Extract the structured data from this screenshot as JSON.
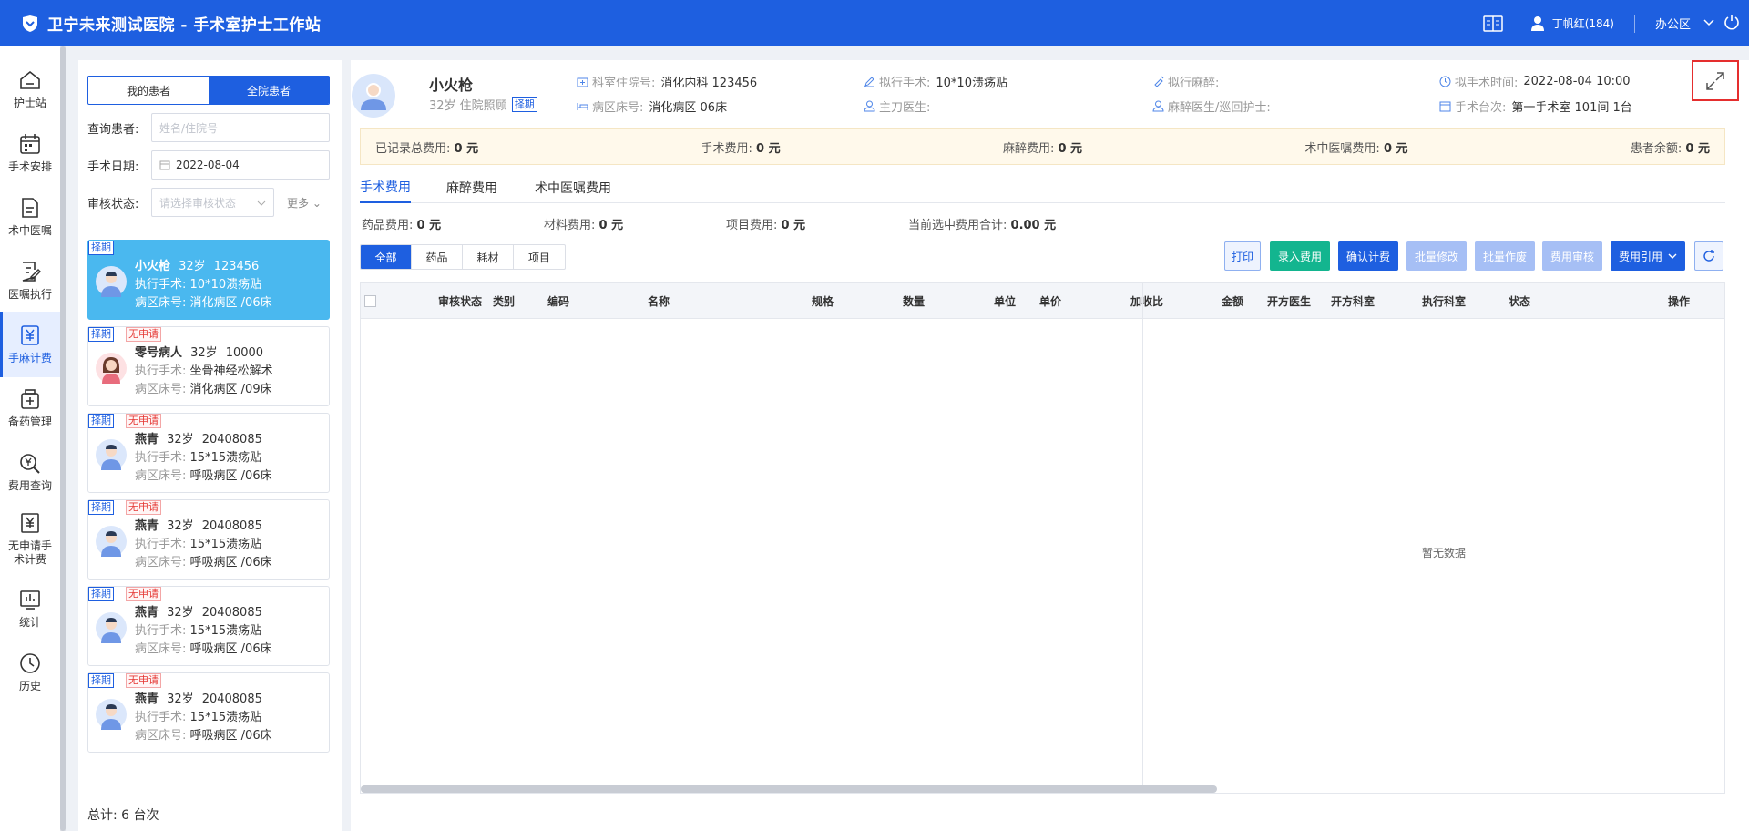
{
  "app": {
    "title": "卫宁未来测试医院 - 手术室护士工作站",
    "user": "丁帆红(184)",
    "office": "办公区"
  },
  "colors": {
    "primary": "#1e5fe0",
    "selected_card": "#4ab8ef",
    "green": "#13b58f",
    "disabled": "#a6bff5"
  },
  "nav": [
    {
      "label": "护士站",
      "icon": "home-icon"
    },
    {
      "label": "手术安排",
      "icon": "calendar-icon"
    },
    {
      "label": "术中医嘱",
      "icon": "document-icon"
    },
    {
      "label": "医嘱执行",
      "icon": "edit-document-icon"
    },
    {
      "label": "手麻计费",
      "icon": "yen-icon"
    },
    {
      "label": "备药管理",
      "icon": "medicine-icon"
    },
    {
      "label": "费用查询",
      "icon": "yen-search-icon"
    },
    {
      "label": "无申请手术计费",
      "icon": "yen-document-icon"
    },
    {
      "label": "统计",
      "icon": "chart-icon"
    },
    {
      "label": "历史",
      "icon": "clock-icon"
    }
  ],
  "left": {
    "seg_my": "我的患者",
    "seg_all": "全院患者",
    "query_label": "查询患者:",
    "query_placeholder": "姓名/住院号",
    "date_label": "手术日期:",
    "date_value": "2022-08-04",
    "audit_label": "审核状态:",
    "audit_placeholder": "请选择审核状态",
    "more": "更多",
    "total": "总计:  6 台次"
  },
  "patients": [
    {
      "tag": "择期",
      "tag2": "",
      "name": "小火枪",
      "age": "32岁",
      "id": "123456",
      "surgery_k": "执行手术:",
      "surgery": "10*10溃疡贴",
      "bed_k": "病区床号:",
      "bed": "消化病区 /06床",
      "avatar": "male"
    },
    {
      "tag": "择期",
      "tag2": "无申请",
      "name": "零号病人",
      "age": "32岁",
      "id": "10000",
      "surgery_k": "执行手术:",
      "surgery": "坐骨神经松解术",
      "bed_k": "病区床号:",
      "bed": "消化病区 /09床",
      "avatar": "female"
    },
    {
      "tag": "择期",
      "tag2": "无申请",
      "name": "燕青",
      "age": "32岁",
      "id": "20408085",
      "surgery_k": "执行手术:",
      "surgery": "15*15溃疡贴",
      "bed_k": "病区床号:",
      "bed": "呼吸病区 /06床",
      "avatar": "male"
    },
    {
      "tag": "择期",
      "tag2": "无申请",
      "name": "燕青",
      "age": "32岁",
      "id": "20408085",
      "surgery_k": "执行手术:",
      "surgery": "15*15溃疡贴",
      "bed_k": "病区床号:",
      "bed": "呼吸病区 /06床",
      "avatar": "male"
    },
    {
      "tag": "择期",
      "tag2": "无申请",
      "name": "燕青",
      "age": "32岁",
      "id": "20408085",
      "surgery_k": "执行手术:",
      "surgery": "15*15溃疡贴",
      "bed_k": "病区床号:",
      "bed": "呼吸病区 /06床",
      "avatar": "male"
    },
    {
      "tag": "择期",
      "tag2": "无申请",
      "name": "燕青",
      "age": "32岁",
      "id": "20408085",
      "surgery_k": "执行手术:",
      "surgery": "15*15溃疡贴",
      "bed_k": "病区床号:",
      "bed": "呼吸病区 /06床",
      "avatar": "male"
    }
  ],
  "header": {
    "name": "小火枪",
    "sub": "32岁 住院照顾",
    "tag": "择期",
    "dept_k": "科室住院号:",
    "dept_v": "消化内科 123456",
    "bed_k": "病区床号:",
    "bed_v": "消化病区 06床",
    "surg_k": "拟行手术:",
    "surg_v": "10*10溃疡贴",
    "doctor_k": "主刀医生:",
    "doctor_v": "",
    "anes_k": "拟行麻醉:",
    "anes_v": "",
    "nurse_k": "麻醉医生/巡回护士:",
    "nurse_v": "",
    "time_k": "拟手术时间:",
    "time_v": "2022-08-04 10:00",
    "room_k": "手术台次:",
    "room_v": "第一手术室 101间 1台"
  },
  "fees": {
    "recorded_k": "已记录总费用:",
    "recorded_v": "0 元",
    "surgery_k": "手术费用:",
    "surgery_v": "0 元",
    "anes_k": "麻醉费用:",
    "anes_v": "0 元",
    "order_k": "术中医嘱费用:",
    "order_v": "0 元",
    "balance_k": "患者余额:",
    "balance_v": "0 元"
  },
  "tabs": [
    "手术费用",
    "麻醉费用",
    "术中医嘱费用"
  ],
  "subtotals": {
    "drug_k": "药品费用:",
    "drug_v": "0 元",
    "material_k": "材料费用:",
    "material_v": "0 元",
    "item_k": "项目费用:",
    "item_v": "0 元",
    "selected_k": "当前选中费用合计:",
    "selected_v": "0.00 元"
  },
  "filters": [
    "全部",
    "药品",
    "耗材",
    "项目"
  ],
  "buttons": {
    "print": "打印",
    "enter": "录入费用",
    "confirm": "确认计费",
    "batch_edit": "批量修改",
    "batch_void": "批量作废",
    "audit": "费用审核",
    "ref": "费用引用"
  },
  "table": {
    "columns": [
      "审核状态",
      "类别",
      "编码",
      "名称",
      "规格",
      "数量",
      "单位",
      "单价",
      "加收比",
      "金额",
      "开方医生",
      "开方科室",
      "执行科室",
      "状态",
      "操作"
    ],
    "empty": "暂无数据"
  }
}
